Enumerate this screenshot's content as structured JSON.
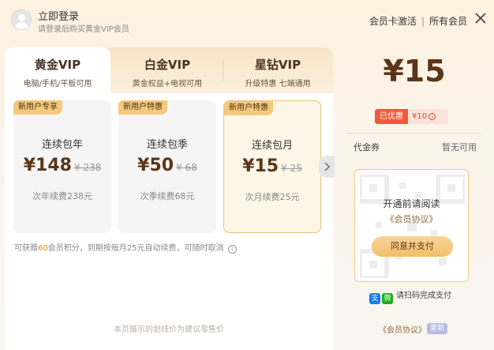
{
  "header": {
    "login_title": "立即登录",
    "login_sub": "请登录后购买黄金VIP会员",
    "link_activate": "会员卡激活",
    "link_separator": "|",
    "link_all": "所有会员"
  },
  "tabs": [
    {
      "title": "黄金VIP",
      "sub": "电脑/手机/平板可用"
    },
    {
      "title": "白金VIP",
      "sub": "黄金权益+电视可用"
    },
    {
      "title": "星钻VIP",
      "sub": "升级特惠 七端通用"
    }
  ],
  "cards": [
    {
      "badge": "新用户专享",
      "name": "连续包年",
      "price": "¥148",
      "orig": "¥ 238",
      "renew": "次年续费238元"
    },
    {
      "badge": "新用户特惠",
      "name": "连续包季",
      "price": "¥50",
      "orig": "¥ 68",
      "renew": "次季续费68元"
    },
    {
      "badge": "新用户特惠",
      "name": "连续包月",
      "price": "¥15",
      "orig": "¥ 25",
      "renew": "次月续费25元"
    }
  ],
  "points_note": {
    "prefix": "可获赠",
    "points": "60",
    "suffix": "会员积分，到期按每月25元自动续费，可随时取消"
  },
  "bottom_note": "本页展示的划线价为建议零售价",
  "summary": {
    "price": "¥15",
    "discount_label": "已优惠",
    "discount_amount": "¥10",
    "voucher_label": "代金券",
    "voucher_value": "暂无可用"
  },
  "qr": {
    "title": "开通前请阅读",
    "agreement": "《会员协议》",
    "button": "同意并支付"
  },
  "pay": {
    "alipay_glyph": "支",
    "wechat_glyph": "微",
    "text": "请扫码完成支付"
  },
  "footer": {
    "agreement": "《会员协议》",
    "badge": "更新"
  },
  "colors": {
    "accent_gold": "#f3bf6a",
    "price_brown": "#5a3618",
    "discount_red": "#f05a3c",
    "selected_border": "#e8c27e"
  },
  "icons": {
    "avatar": "user-avatar-icon",
    "close": "close-icon",
    "arrow": "chevron-right-icon",
    "info": "info-icon",
    "alipay": "alipay-icon",
    "wechat": "wechat-pay-icon"
  }
}
